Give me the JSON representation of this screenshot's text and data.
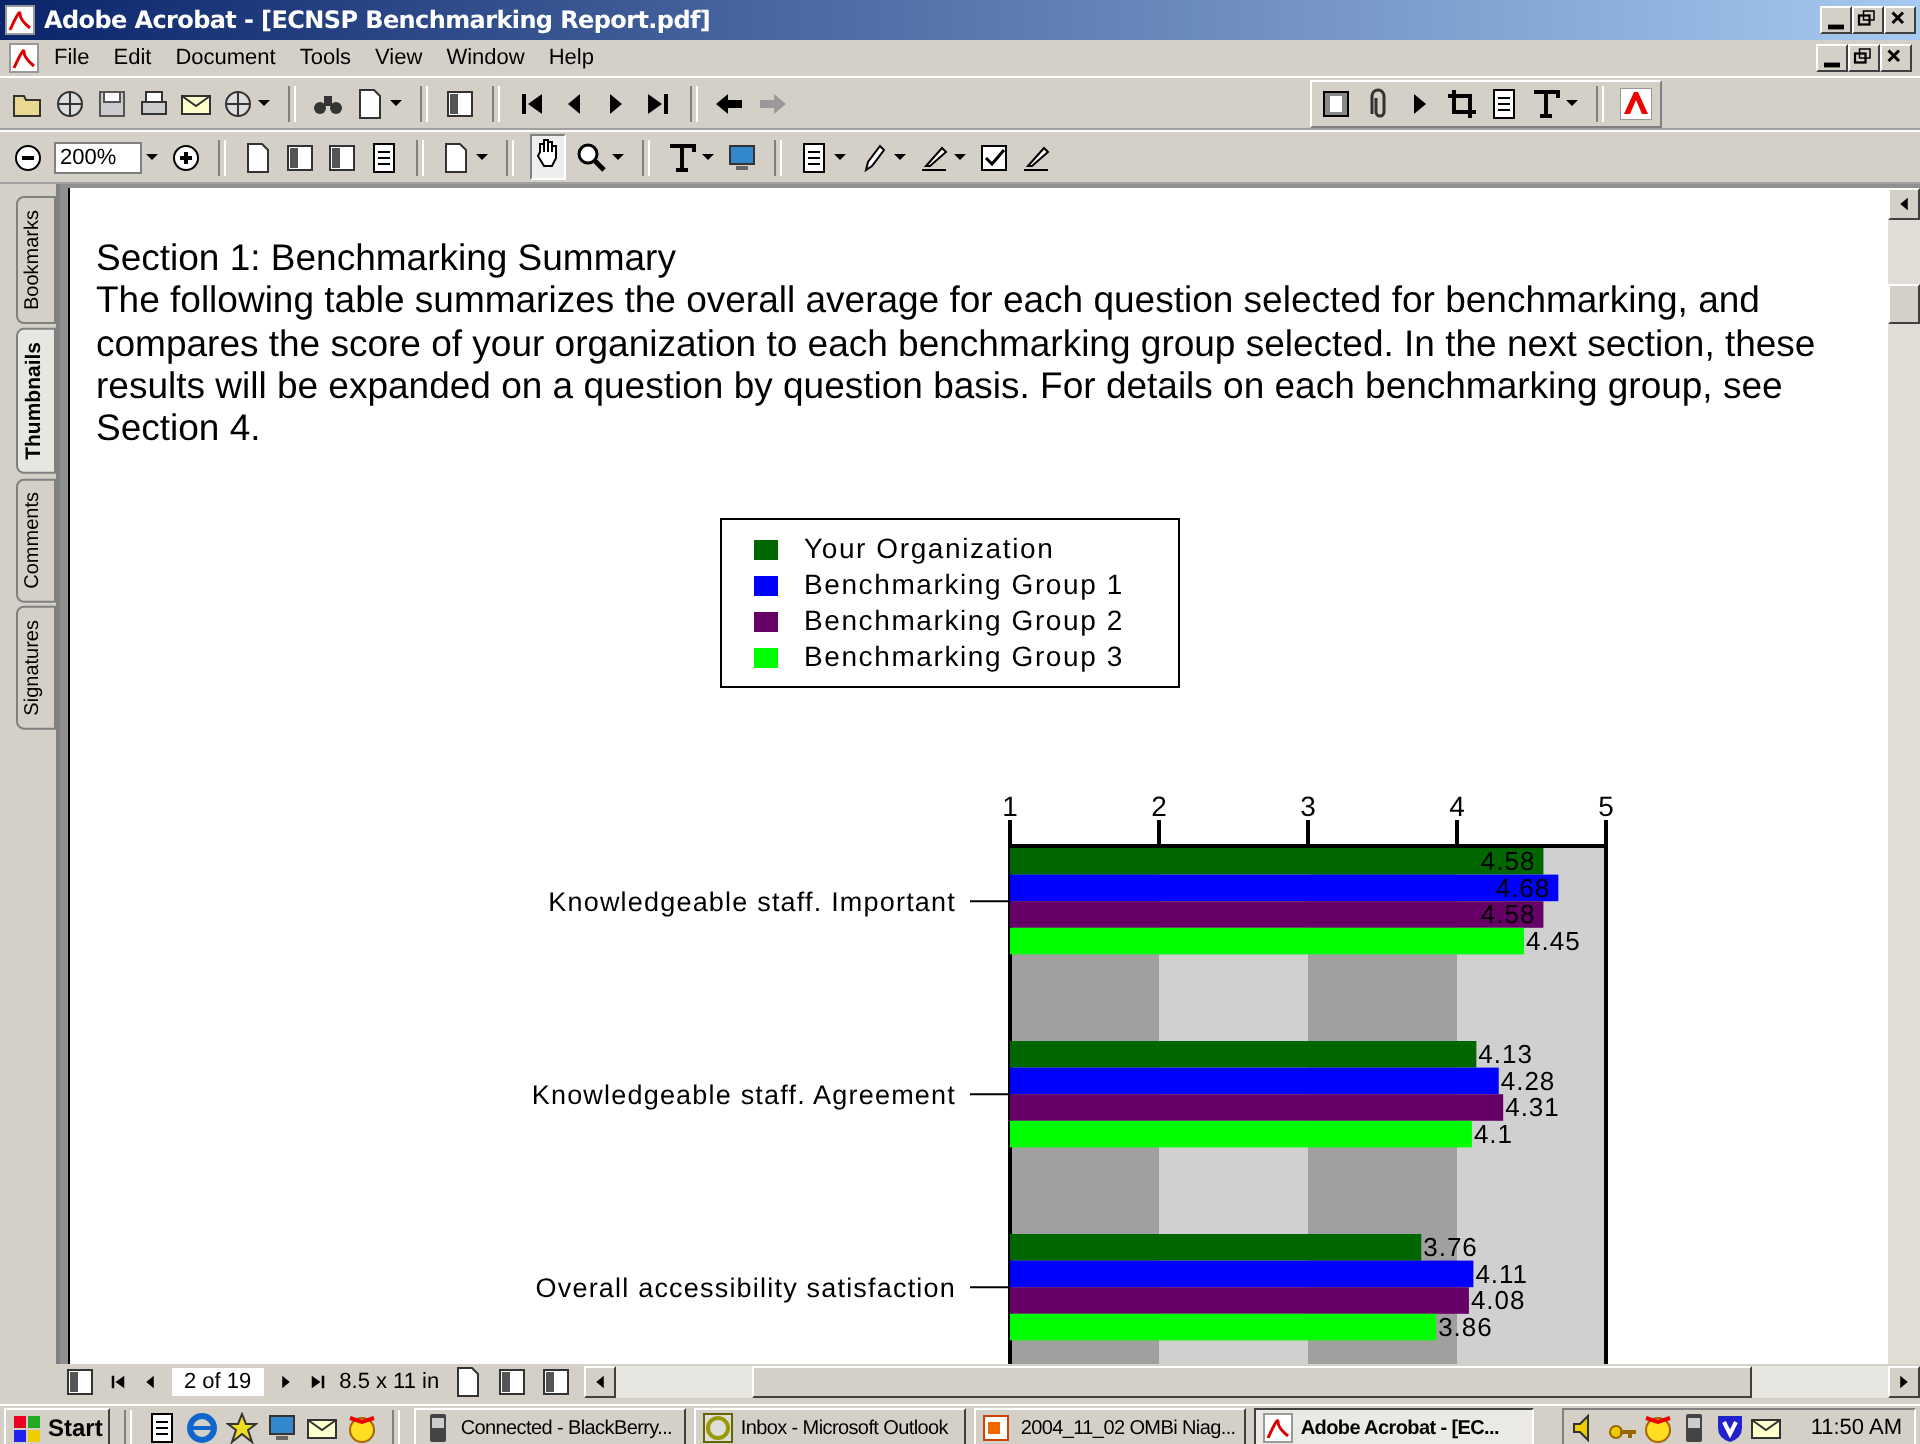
{
  "window": {
    "title": "Adobe Acrobat - [ECNSP Benchmarking Report.pdf]"
  },
  "menu": [
    "File",
    "Edit",
    "Document",
    "Tools",
    "View",
    "Window",
    "Help"
  ],
  "toolbar": {
    "zoom": "200%"
  },
  "side_tabs": [
    {
      "label": "Bookmarks",
      "selected": false
    },
    {
      "label": "Thumbnails",
      "selected": true
    },
    {
      "label": "Comments",
      "selected": false
    },
    {
      "label": "Signatures",
      "selected": false
    }
  ],
  "document": {
    "heading": "Section 1: Benchmarking Summary",
    "paragraph": "The following table summarizes the overall average for each question selected for benchmarking, and compares the score of your organization to each benchmarking group selected. In the next section, these results will be expanded on a question by question basis. For details on each benchmarking group, see Section 4.",
    "chart_data": {
      "type": "bar",
      "orientation": "horizontal",
      "categories": [
        "Knowledgeable staff. Important",
        "Knowledgeable staff. Agreement",
        "Overall accessibility satisfaction"
      ],
      "series": [
        {
          "name": "Your Organization",
          "color": "#006600",
          "values": [
            4.58,
            4.13,
            3.76
          ]
        },
        {
          "name": "Benchmarking Group 1",
          "color": "#0000ff",
          "values": [
            4.68,
            4.28,
            4.11
          ]
        },
        {
          "name": "Benchmarking Group 2",
          "color": "#660066",
          "values": [
            4.58,
            4.31,
            4.08
          ]
        },
        {
          "name": "Benchmarking Group 3",
          "color": "#00ff00",
          "values": [
            4.45,
            4.1,
            3.86
          ]
        }
      ],
      "xlim": [
        1,
        5
      ],
      "xticks": [
        1,
        2,
        3,
        4,
        5
      ],
      "data_labels": true,
      "legend": "top"
    }
  },
  "navigation": {
    "page": "2 of 19",
    "page_size": "8.5 x 11 in"
  },
  "taskbar": {
    "start": "Start",
    "tasks": [
      {
        "label": "Connected - BlackBerry...",
        "selected": false
      },
      {
        "label": "Inbox - Microsoft Outlook",
        "selected": false
      },
      {
        "label": "2004_11_02 OMBi Niag...",
        "selected": false
      },
      {
        "label": "Adobe Acrobat - [EC...",
        "selected": true
      }
    ],
    "clock": "11:50 AM"
  }
}
